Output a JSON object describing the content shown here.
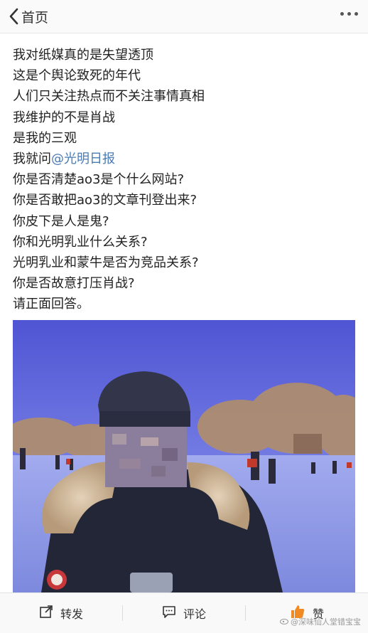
{
  "nav": {
    "back_label": "首页"
  },
  "post": {
    "lines": [
      "我对纸媒真的是失望透顶",
      "这是个舆论致死的年代",
      "人们只关注热点而不关注事情真相",
      "我维护的不是肖战",
      "是我的三观"
    ],
    "ask_prefix": "我就问",
    "mention": "@光明日报",
    "questions": [
      "你是否清楚ao3是个什么网站?",
      "你是否敢把ao3的文章刊登出来?",
      "你皮下是人是鬼?",
      "你和光明乳业什么关系?",
      "光明乳业和蒙牛是否为竞品关系?",
      "你是否故意打压肖战?",
      "请正面回答。"
    ]
  },
  "actions": {
    "repost": "转发",
    "comment": "评论",
    "like": "赞"
  },
  "watermark": "@深味仙人堂错宝宝",
  "colors": {
    "mention": "#4a7bb5",
    "like_icon": "#f08a24",
    "sky": "#5b62d8",
    "ice": "#8e9ae6"
  }
}
